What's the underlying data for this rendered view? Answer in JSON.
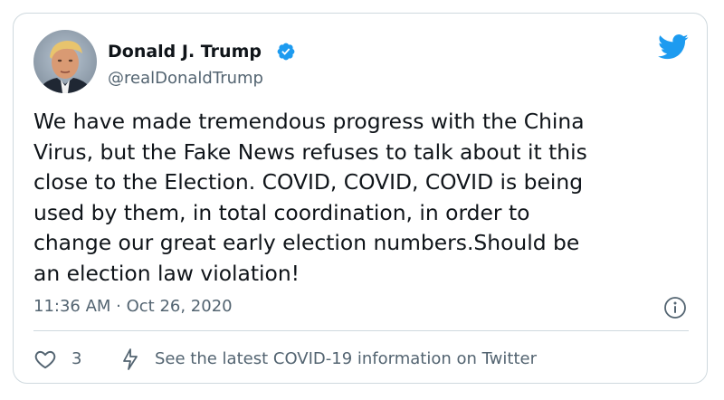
{
  "author": {
    "name": "Donald J. Trump",
    "handle": "@realDonaldTrump",
    "verified": true
  },
  "tweet": {
    "text": "We have made tremendous progress with the China\nVirus, but the Fake News refuses to talk about it this\nclose to the Election. COVID, COVID, COVID is being\nused by them, in total coordination, in order to\nchange our great early election numbers.Should be\nan election law violation!",
    "timestamp": "11:36 AM · Oct 26, 2020"
  },
  "actions": {
    "like_count": "3",
    "covid_link": "See the latest COVID-19 information on Twitter"
  },
  "icons": {
    "brand": "twitter-bird-icon",
    "verified": "verified-badge-icon",
    "info": "info-icon",
    "like": "heart-icon",
    "covid": "lightning-bolt-icon"
  },
  "colors": {
    "brand_blue": "#1d9bf0",
    "text_primary": "#0f1419",
    "text_secondary": "#536471",
    "border": "#cfd9de"
  }
}
